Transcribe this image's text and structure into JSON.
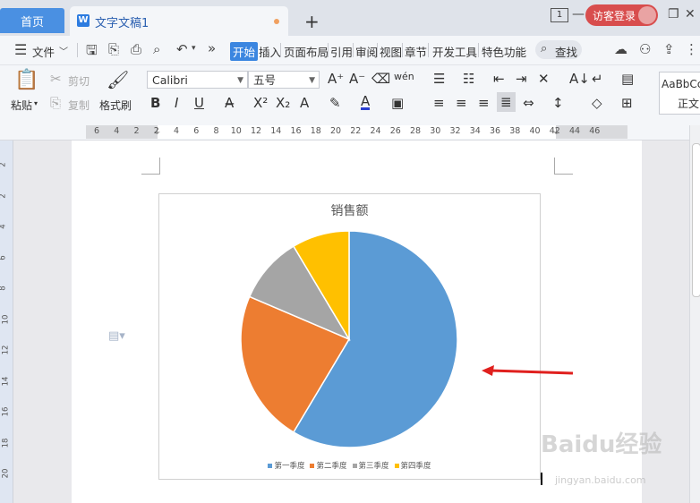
{
  "tabs": {
    "home_label": "首页",
    "doc_label": "文字文稿1",
    "new_tab": "+"
  },
  "titlebar": {
    "page_count": "1",
    "login_label": "访客登录"
  },
  "menu": {
    "file_label": "文件",
    "items": [
      "开始",
      "插入",
      "页面布局",
      "引用",
      "审阅",
      "视图",
      "章节",
      "开发工具",
      "特色功能"
    ],
    "search_label": "查找"
  },
  "ribbon": {
    "paste_label": "粘贴",
    "cut_label": "剪切",
    "copy_label": "复制",
    "format_painter_label": "格式刷",
    "font_name": "Calibri",
    "font_size": "五号",
    "style_preview": "AaBbCc",
    "style_name": "正文"
  },
  "ruler": {
    "h_ticks": [
      "6",
      "4",
      "2",
      "2",
      "4",
      "6",
      "8",
      "10",
      "12",
      "14",
      "16",
      "18",
      "20",
      "22",
      "24",
      "26",
      "28",
      "30",
      "32",
      "34",
      "36",
      "38",
      "40",
      "42",
      "44",
      "46"
    ],
    "v_ticks": [
      "2",
      "2",
      "4",
      "6",
      "8",
      "10",
      "12",
      "14",
      "16",
      "18",
      "20"
    ]
  },
  "chart_data": {
    "type": "pie",
    "title": "销售额",
    "categories": [
      "第一季度",
      "第二季度",
      "第三季度",
      "第四季度"
    ],
    "values": [
      8.2,
      3.2,
      1.4,
      1.2
    ],
    "colors": [
      "#5b9bd5",
      "#ed7d31",
      "#a5a5a5",
      "#ffc000"
    ],
    "legend_position": "bottom"
  },
  "annotation": {
    "arrow_color": "#e0201e"
  },
  "watermark": {
    "text": "Baidu经验",
    "sub": "jingyan.baidu.com"
  }
}
